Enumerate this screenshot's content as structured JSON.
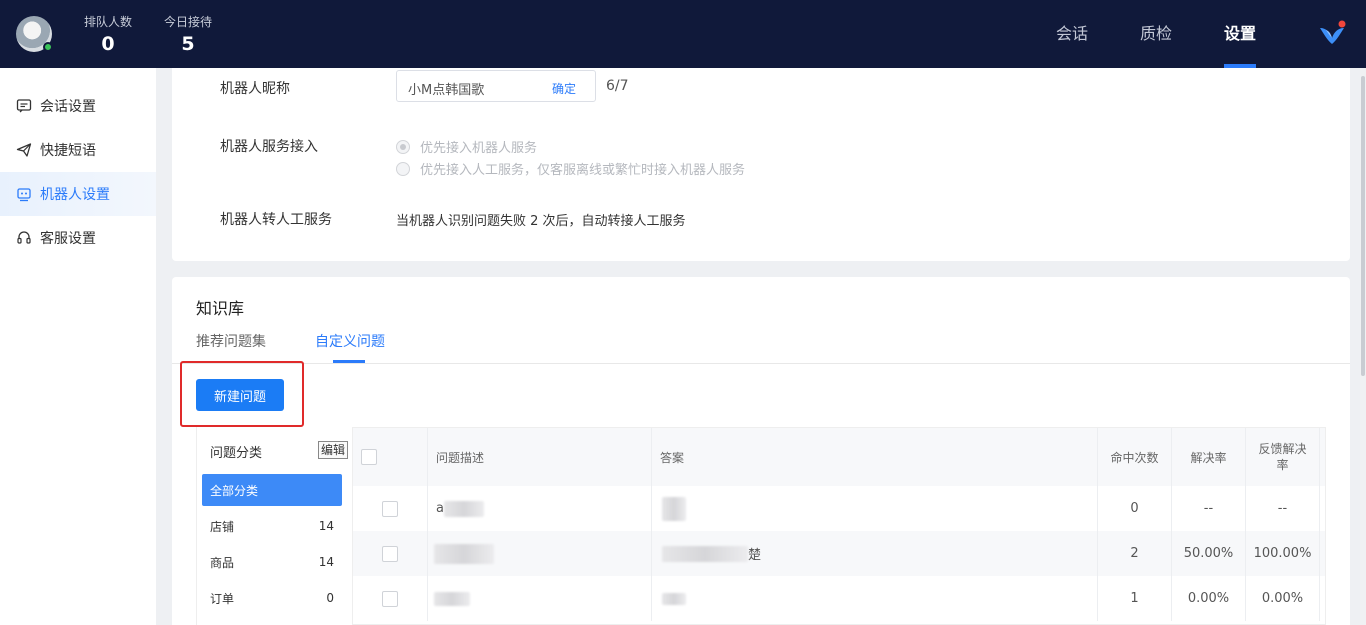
{
  "header": {
    "queue_label": "排队人数",
    "queue_value": "0",
    "today_label": "今日接待",
    "today_value": "5",
    "nav": [
      "会话",
      "质检",
      "设置"
    ],
    "active_nav": "设置",
    "online_color": "#3bc45a"
  },
  "sidebar": {
    "items": [
      {
        "label": "会话设置",
        "icon": "chat-bubble-icon"
      },
      {
        "label": "快捷短语",
        "icon": "paper-plane-icon"
      },
      {
        "label": "机器人设置",
        "icon": "robot-icon"
      },
      {
        "label": "客服设置",
        "icon": "headset-icon"
      }
    ],
    "active_index": 2
  },
  "robot": {
    "nickname_label": "机器人昵称",
    "nickname_value": "小M点韩国歌",
    "nickname_confirm": "确定",
    "nickname_count": "6/7",
    "service_label": "机器人服务接入",
    "service_options": [
      "优先接入机器人服务",
      "优先接入人工服务，仅客服离线或繁忙时接入机器人服务"
    ],
    "service_selected": 0,
    "transfer_label": "机器人转人工服务",
    "transfer_text": "当机器人识别问题失败 2 次后，自动转接人工服务"
  },
  "knowledge": {
    "title": "知识库",
    "tabs": [
      "推荐问题集",
      "自定义问题"
    ],
    "active_tab": 1,
    "new_button": "新建问题",
    "category_title": "问题分类",
    "category_edit": "编辑",
    "categories": [
      {
        "name": "全部分类",
        "count": ""
      },
      {
        "name": "店铺",
        "count": "14"
      },
      {
        "name": "商品",
        "count": "14"
      },
      {
        "name": "订单",
        "count": "0"
      }
    ],
    "columns": [
      "问题描述",
      "答案",
      "命中次数",
      "解决率",
      "反馈解决率"
    ],
    "rows": [
      {
        "question": "a",
        "answer": "",
        "hits": "0",
        "resolve": "--",
        "feedback": "--"
      },
      {
        "question": "",
        "answer": "楚",
        "hits": "2",
        "resolve": "50.00%",
        "feedback": "100.00%"
      },
      {
        "question": "",
        "answer": "",
        "hits": "1",
        "resolve": "0.00%",
        "feedback": "0.00%"
      }
    ]
  },
  "colors": {
    "topbar": "#10193a",
    "accent": "#2b7bfa",
    "highlight_border": "#e02a2a"
  }
}
